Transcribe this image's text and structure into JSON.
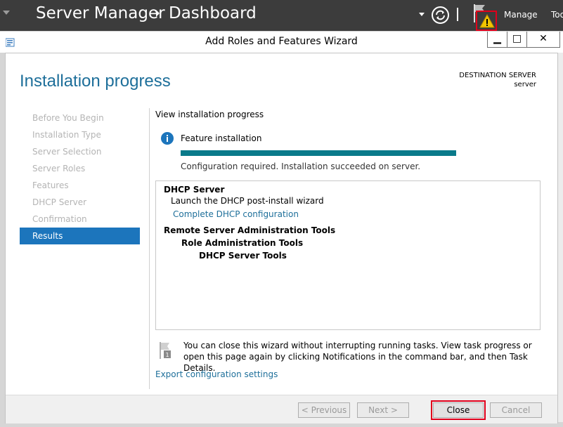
{
  "server_manager": {
    "title": "Server Manager",
    "breadcrumb": "Dashboard",
    "menu": [
      "Manage",
      "Too"
    ]
  },
  "window": {
    "title": "Add Roles and Features Wizard",
    "minimize": "▁",
    "maximize": "□",
    "close": "✕"
  },
  "header": {
    "page_title": "Installation progress",
    "destination_label": "DESTINATION SERVER",
    "destination_value": "server"
  },
  "nav": {
    "items": [
      {
        "label": "Before You Begin",
        "state": "disabled"
      },
      {
        "label": "Installation Type",
        "state": "disabled"
      },
      {
        "label": "Server Selection",
        "state": "disabled"
      },
      {
        "label": "Server Roles",
        "state": "disabled"
      },
      {
        "label": "Features",
        "state": "disabled"
      },
      {
        "label": "DHCP Server",
        "state": "disabled"
      },
      {
        "label": "Confirmation",
        "state": "disabled"
      },
      {
        "label": "Results",
        "state": "active"
      }
    ]
  },
  "progress": {
    "heading": "View installation progress",
    "feature_label": "Feature installation",
    "percent": 100,
    "status": "Configuration required. Installation succeeded on server."
  },
  "results": {
    "dhcp_title": "DHCP Server",
    "dhcp_line": "Launch the DHCP post-install wizard",
    "dhcp_link": "Complete DHCP configuration",
    "rsat_title": "Remote Server Administration Tools",
    "rsat_role": "Role Administration Tools",
    "rsat_dhcp": "DHCP Server Tools"
  },
  "note": {
    "text": "You can close this wizard without interrupting running tasks. View task progress or open this page again by clicking Notifications in the command bar, and then Task Details."
  },
  "export_link": "Export configuration settings",
  "buttons": {
    "previous": "< Previous",
    "next": "Next >",
    "close": "Close",
    "cancel": "Cancel"
  },
  "colors": {
    "accent": "#1c75bc",
    "progress": "#0a7a8a",
    "highlight": "#e0001b",
    "warning": "#f2c500"
  }
}
